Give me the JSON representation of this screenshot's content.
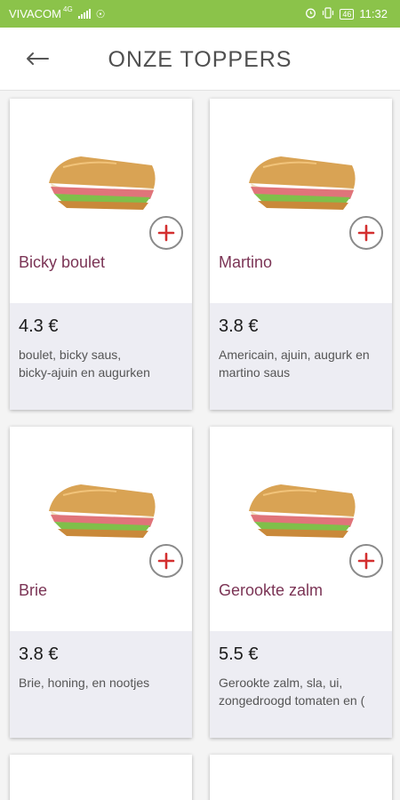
{
  "status_bar": {
    "carrier": "VIVACOM",
    "network_tag": "4G",
    "battery": "46",
    "time": "11:32"
  },
  "header": {
    "title": "ONZE TOPPERS"
  },
  "products": [
    {
      "name": "Bicky boulet",
      "price": "4.3  €",
      "description_lines": [
        "boulet, bicky saus,",
        "bicky-ajuin en augurken"
      ]
    },
    {
      "name": "Martino",
      "price": "3.8  €",
      "description_lines": [
        "Americain, ajuin, augurk en",
        "martino saus"
      ]
    },
    {
      "name": "Brie",
      "price": "3.8  €",
      "description_lines": [
        "Brie, honing, en nootjes",
        ""
      ]
    },
    {
      "name": "Gerookte zalm",
      "price": "5.5  €",
      "description_lines": [
        "Gerookte zalm, sla, ui,",
        "zongedroogd tomaten en ("
      ]
    }
  ],
  "colors": {
    "status_bar": "#8bc34a",
    "product_name": "#7b3455",
    "add_button_plus": "#d32f2f",
    "card_bottom": "#ededf3"
  },
  "icons": {
    "back": "arrow-left-icon",
    "add": "plus-circle-icon",
    "alarm": "alarm-icon",
    "vibrate": "vibrate-icon",
    "usb": "usb-icon"
  }
}
